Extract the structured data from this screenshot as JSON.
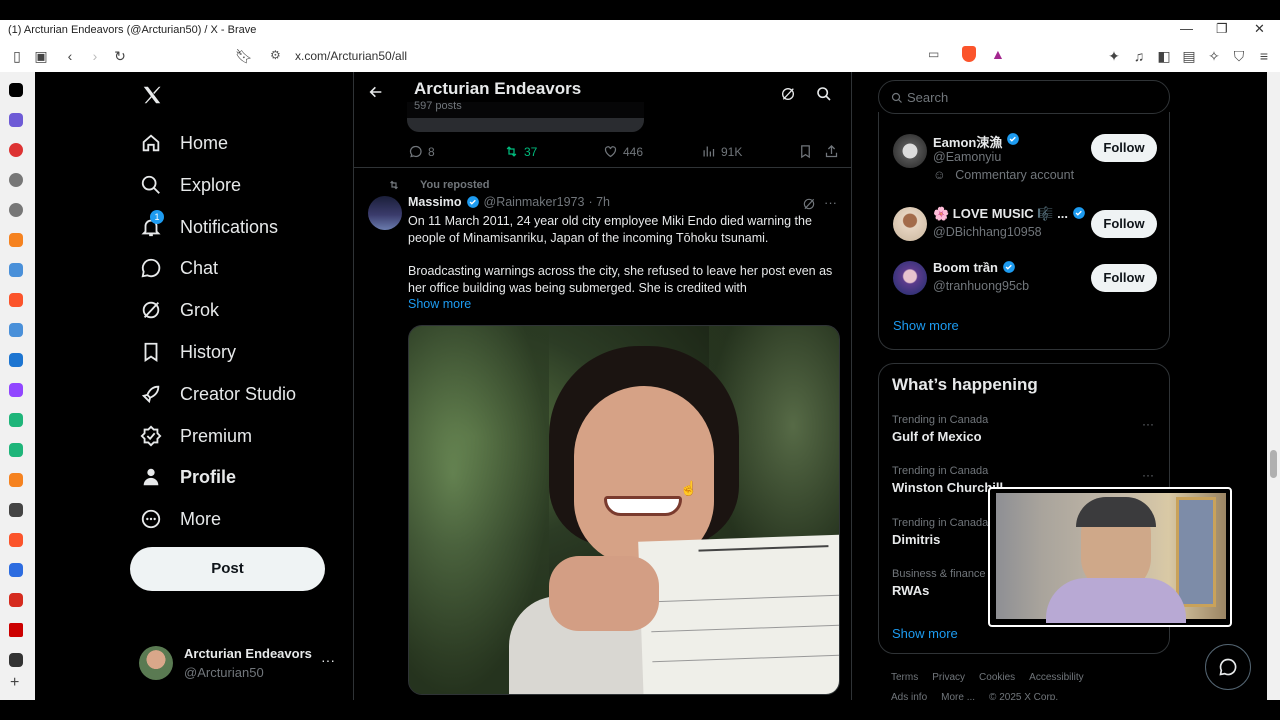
{
  "browser": {
    "window_title": "(1) Arcturian Endeavors (@Arcturian50) / X - Brave",
    "url": "x.com/Arcturian50/all",
    "controls": {
      "minimize": "—",
      "restore": "❐",
      "close": "✕"
    }
  },
  "nav": {
    "logo": "x-logo-icon",
    "items": [
      {
        "label": "Home",
        "icon": "home-icon"
      },
      {
        "label": "Explore",
        "icon": "search-icon"
      },
      {
        "label": "Notifications",
        "icon": "bell-icon",
        "badge": "1"
      },
      {
        "label": "Chat",
        "icon": "chat-icon"
      },
      {
        "label": "Grok",
        "icon": "grok-icon"
      },
      {
        "label": "History",
        "icon": "bookmark-icon"
      },
      {
        "label": "Creator Studio",
        "icon": "rocket-icon"
      },
      {
        "label": "Premium",
        "icon": "premium-icon"
      },
      {
        "label": "Profile",
        "icon": "profile-icon"
      },
      {
        "label": "More",
        "icon": "more-icon"
      }
    ],
    "post_label": "Post",
    "account": {
      "name": "Arcturian Endeavors",
      "handle": "@Arcturian50",
      "menu": "···"
    }
  },
  "header": {
    "title": "Arcturian Endeavors",
    "subtitle": "597 posts"
  },
  "prev_post": {
    "replies": "8",
    "reposts": "37",
    "likes": "446",
    "views": "91K"
  },
  "tweet": {
    "repost_note": "You reposted",
    "author": "Massimo",
    "handle": "@Rainmaker1973",
    "time": "· 7h",
    "text1": "On 11 March 2011, 24 year old city employee Miki Endo died warning the people of Minamisanriku, Japan of the incoming Tōhoku tsunami.",
    "text2": "Broadcasting warnings across the city, she refused to leave her post even as her office building was being submerged. She is credited with",
    "show_more": "Show more",
    "menu": "···"
  },
  "search": {
    "placeholder": "Search"
  },
  "who_to_follow": {
    "items": [
      {
        "name": "Eamon涑漁",
        "handle": "@Eamonyiu",
        "note": "Commentary account",
        "follow": "Follow"
      },
      {
        "name": "🌸 LOVE MUSIC 🎼 ...",
        "handle": "@DBichhang10958",
        "follow": "Follow"
      },
      {
        "name": "Boom trần",
        "handle": "@tranhuong95cb",
        "follow": "Follow"
      }
    ],
    "show_more": "Show more"
  },
  "happening": {
    "title": "What’s happening",
    "trends": [
      {
        "category": "Trending in Canada",
        "name": "Gulf of Mexico",
        "menu": "···"
      },
      {
        "category": "Trending in Canada",
        "name": "Winston Churchill",
        "menu": "···"
      },
      {
        "category": "Trending in Canada",
        "name": "Dimitris"
      },
      {
        "category": "Business & finance",
        "name": "RWAs"
      }
    ],
    "show_more": "Show more"
  },
  "footer": {
    "links": [
      "Terms",
      "Privacy",
      "Cookies",
      "Accessibility"
    ],
    "links2": [
      "Ads info",
      "More ...",
      "© 2025 X Corp."
    ]
  },
  "colors": {
    "accent": "#1d9bf0",
    "repost_green": "#00ba7c",
    "bg": "#000000",
    "border": "#2f3336"
  }
}
